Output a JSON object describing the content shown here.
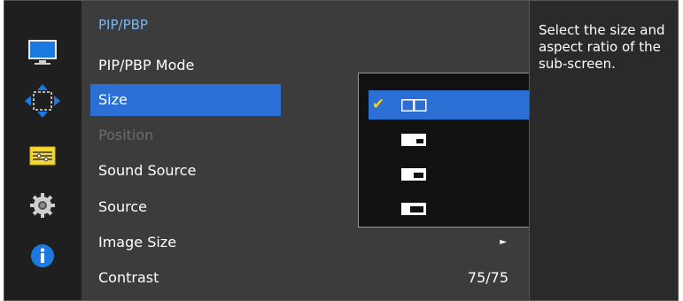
{
  "rail": {
    "icons": [
      "picture-icon",
      "pip-move-icon",
      "settings-sliders-icon",
      "gear-icon",
      "info-icon"
    ]
  },
  "menu": {
    "title": "PIP/PBP",
    "items": [
      {
        "label": "PIP/PBP Mode"
      },
      {
        "label": "Size"
      },
      {
        "label": "Position"
      },
      {
        "label": "Sound Source"
      },
      {
        "label": "Source"
      },
      {
        "label": "Image Size"
      },
      {
        "label": "Contrast",
        "value": "75/75"
      }
    ]
  },
  "dropdown": {
    "selected_index": 0,
    "options": [
      "pbp-side-by-side-icon",
      "pip-small-icon",
      "pip-medium-icon",
      "pip-large-icon"
    ]
  },
  "help": {
    "text": "Select the size and aspect ratio of the sub-screen."
  },
  "colors": {
    "highlight": "#2b6fd4",
    "title": "#78b6f3",
    "check": "#f2d21a",
    "disabled": "#6b6b6b"
  }
}
